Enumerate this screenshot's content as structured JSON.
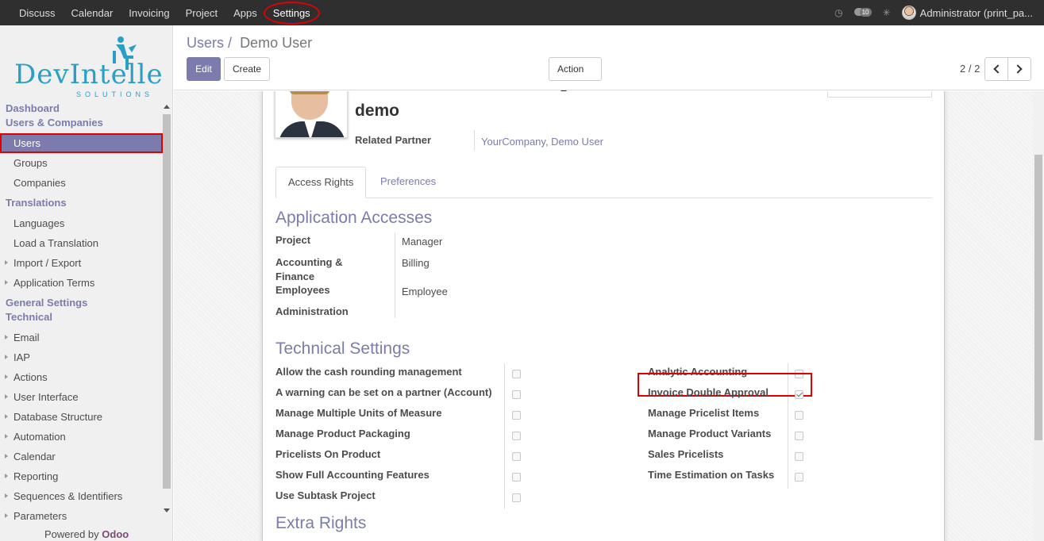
{
  "topbar": {
    "menu": [
      "Discuss",
      "Calendar",
      "Invoicing",
      "Project",
      "Apps",
      "Settings"
    ],
    "chat_count": "10",
    "user": "Administrator (print_pa..."
  },
  "sidebar": {
    "logo": {
      "word_a": "Dev",
      "word_b": "Intelle",
      "sub": "SOLUTIONS"
    },
    "sections": [
      {
        "header": "Dashboard"
      },
      {
        "header": "Users & Companies",
        "items": [
          "Users",
          "Groups",
          "Companies"
        ]
      },
      {
        "header": "Translations",
        "items": [
          "Languages",
          "Load a Translation",
          "Import / Export",
          "Application Terms"
        ]
      },
      {
        "header": "General Settings"
      },
      {
        "header": "Technical",
        "items": [
          "Email",
          "IAP",
          "Actions",
          "User Interface",
          "Database Structure",
          "Automation",
          "Calendar",
          "Reporting",
          "Sequences & Identifiers",
          "Parameters"
        ]
      }
    ],
    "powered_prefix": "Powered by",
    "powered_brand": "Odoo"
  },
  "control": {
    "breadcrumb_parent": "Users",
    "breadcrumb_sep": "/",
    "breadcrumb_current": "Demo User",
    "edit": "Edit",
    "create": "Create",
    "action": "Action",
    "pager": "2 / 2"
  },
  "form": {
    "name": "demo",
    "related_partner_label": "Related Partner",
    "related_partner_value": "YourCompany, Demo User",
    "tabs": [
      "Access Rights",
      "Preferences"
    ],
    "app_access_title": "Application Accesses",
    "app_access": [
      {
        "label": "Project",
        "value": "Manager"
      },
      {
        "label": "Accounting & Finance",
        "value": "Billing"
      },
      {
        "label": "Employees",
        "value": "Employee"
      },
      {
        "label": "Administration",
        "value": ""
      }
    ],
    "tech_title": "Technical Settings",
    "tech_left": [
      {
        "label": "Allow the cash rounding management",
        "checked": false
      },
      {
        "label": "A warning can be set on a partner (Account)",
        "checked": false
      },
      {
        "label": "Manage Multiple Units of Measure",
        "checked": false
      },
      {
        "label": "Manage Product Packaging",
        "checked": false
      },
      {
        "label": "Pricelists On Product",
        "checked": false
      },
      {
        "label": "Show Full Accounting Features",
        "checked": false
      },
      {
        "label": "Use Subtask Project",
        "checked": false
      }
    ],
    "tech_right": [
      {
        "label": "Analytic Accounting",
        "checked": false
      },
      {
        "label": "Invoice Double Approval",
        "checked": true
      },
      {
        "label": "Manage Pricelist Items",
        "checked": false
      },
      {
        "label": "Manage Product Variants",
        "checked": false
      },
      {
        "label": "Sales Pricelists",
        "checked": false
      },
      {
        "label": "Time Estimation on Tasks",
        "checked": false
      }
    ],
    "extra_title": "Extra Rights"
  }
}
